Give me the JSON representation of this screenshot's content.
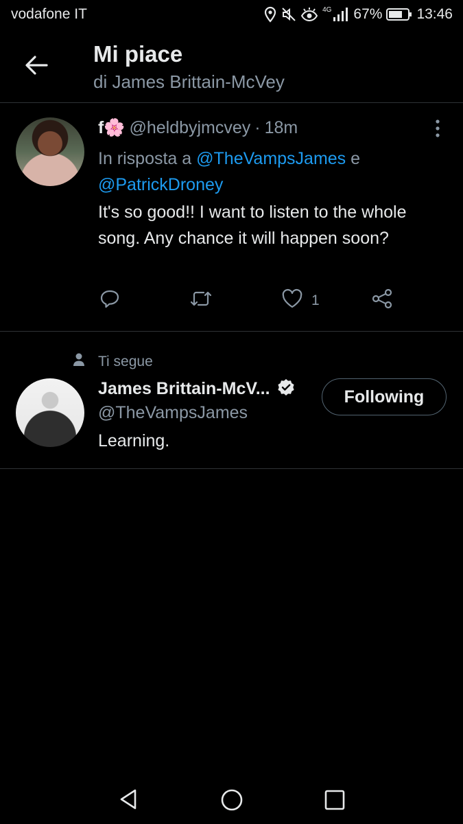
{
  "status_bar": {
    "carrier": "vodafone IT",
    "network": "4G",
    "battery": "67%",
    "time": "13:46",
    "icons": [
      "location-icon",
      "mute-icon",
      "eye-comfort-icon",
      "signal-icon",
      "battery-icon"
    ]
  },
  "header": {
    "title": "Mi piace",
    "subtitle": "di James Brittain-McVey",
    "back_icon": "arrow-left-icon"
  },
  "tweet": {
    "author_name": "f🌸",
    "handle": "@heldbyjmcvey",
    "separator": "·",
    "time": "18m",
    "reply_prefix": "In risposta a",
    "reply_mention_1": "@TheVampsJames",
    "reply_conjunction": "e",
    "reply_mention_2": "@PatrickDroney",
    "text": "It's so good!! I want to listen to the whole song. Any chance it will happen soon?",
    "likes": "1",
    "actions": [
      "reply-icon",
      "retweet-icon",
      "like-icon",
      "share-icon"
    ]
  },
  "user_card": {
    "follows_label": "Ti segue",
    "name": "James Brittain-McV...",
    "verified": true,
    "handle": "@TheVampsJames",
    "bio": "Learning.",
    "follow_button": "Following"
  },
  "nav_bar": {
    "icons": [
      "nav-back-icon",
      "nav-home-icon",
      "nav-recents-icon"
    ]
  },
  "colors": {
    "background": "#000000",
    "text": "#e7e9ea",
    "secondary_text": "#8b98a5",
    "link": "#1d9bf0",
    "divider": "#2f3336"
  }
}
